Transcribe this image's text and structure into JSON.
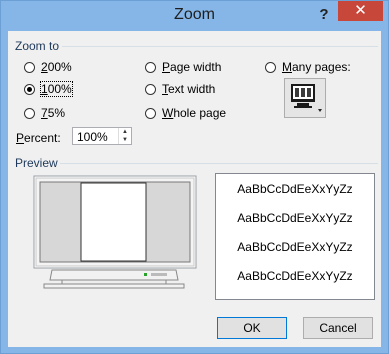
{
  "window": {
    "title": "Zoom",
    "help_glyph": "?",
    "close_glyph": "✕"
  },
  "zoom_to": {
    "label": "Zoom to",
    "options": [
      {
        "key": "200",
        "mn": "2",
        "rest": "00%"
      },
      {
        "key": "100",
        "mn": "1",
        "rest": "00%"
      },
      {
        "key": "75",
        "mn": "7",
        "rest": "5%"
      },
      {
        "key": "page_width",
        "mn": "P",
        "rest": "age width"
      },
      {
        "key": "text_width",
        "mn": "T",
        "rest": "ext width"
      },
      {
        "key": "whole_page",
        "mn": "W",
        "rest": "hole page"
      },
      {
        "key": "many_pages",
        "mn": "M",
        "rest": "any pages:"
      }
    ],
    "selected": "100"
  },
  "percent": {
    "mn": "P",
    "rest": "ercent:",
    "value": "100%"
  },
  "preview": {
    "label": "Preview",
    "sample_lines": [
      "AaBbCcDdEeXxYyZz",
      "AaBbCcDdEeXxYyZz",
      "AaBbCcDdEeXxYyZz",
      "AaBbCcDdEeXxYyZz"
    ]
  },
  "buttons": {
    "ok": "OK",
    "cancel": "Cancel"
  },
  "icons": {
    "help": "help-icon",
    "close": "close-icon",
    "monitor": "monitor-pages-icon",
    "spin_up": "chevron-up-icon",
    "spin_down": "chevron-down-icon"
  },
  "colors": {
    "titlebar": "#85b6e7",
    "close": "#c7473b",
    "client": "#f0f0f0",
    "accent": "#0078d7"
  }
}
